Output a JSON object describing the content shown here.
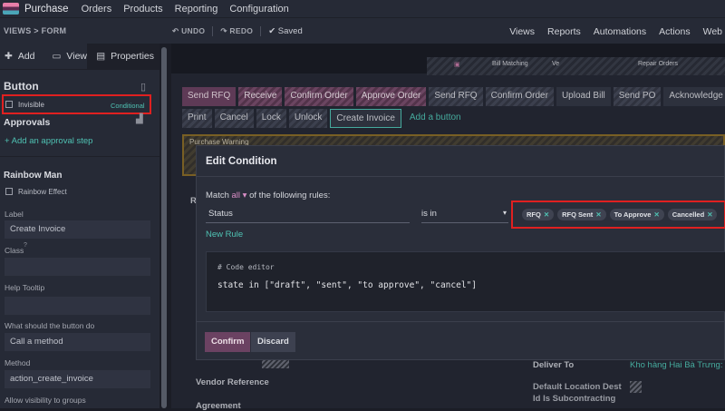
{
  "app": {
    "name": "Purchase",
    "menu": [
      "Orders",
      "Products",
      "Reporting",
      "Configuration"
    ]
  },
  "subbar": {
    "breadcrumb": "VIEWS  >  FORM",
    "undo": "UNDO",
    "redo": "REDO",
    "saved": "Saved",
    "right_menu": [
      "Views",
      "Reports",
      "Automations",
      "Actions",
      "Web"
    ]
  },
  "sidebar": {
    "tabs": {
      "add": "Add",
      "view": "View",
      "properties": "Properties"
    },
    "section_title": "Button",
    "invisible_label": "Invisible",
    "invisible_badge": "Conditional",
    "approvals_title": "Approvals",
    "add_approval": "Add an approval step",
    "rainbow_title": "Rainbow Man",
    "rainbow_effect": "Rainbow Effect",
    "label_label": "Label",
    "label_value": "Create Invoice",
    "class_label": "Class",
    "tooltip_label": "Help Tooltip",
    "action_label": "What should the button do",
    "action_value": "Call a method",
    "method_label": "Method",
    "method_value": "action_create_invoice",
    "visibility_label": "Allow visibility to groups"
  },
  "smart_buttons": [
    "Bill Matching",
    "Ve",
    "Repair Orders"
  ],
  "header_buttons_row1": [
    "Send RFQ",
    "Receive",
    "Confirm Order",
    "Approve Order",
    "Send RFQ",
    "Confirm Order",
    "Upload Bill",
    "Send PO",
    "Acknowledge"
  ],
  "header_buttons_row2": [
    "Print",
    "Cancel",
    "Lock",
    "Unlock",
    "Create Invoice",
    "Add a button"
  ],
  "warning_text": "Purchase Warning",
  "form_labels": {
    "r": "R",
    "vendor_reference": "Vendor Reference",
    "agreement": "Agreement",
    "deliver_to": "Deliver To",
    "deliver_to_value": "Kho hàng Hai Bà Trưng: Re",
    "default_location": "Default Location Dest",
    "subcontracting": "Id Is Subcontracting"
  },
  "modal": {
    "title": "Edit Condition",
    "match_prefix": "Match",
    "match_all": "all",
    "match_suffix": "of the following rules:",
    "field": "Status",
    "operator": "is in",
    "tags": [
      "RFQ",
      "RFQ Sent",
      "To Approve",
      "Cancelled"
    ],
    "new_rule": "New Rule",
    "code_comment": "# Code editor",
    "code_line": "state in [\"draft\", \"sent\", \"to approve\", \"cancel\"]",
    "confirm": "Confirm",
    "discard": "Discard"
  },
  "colors": {
    "accent": "#4fc2b3",
    "primary": "#6b4262",
    "highlight": "#e02020"
  }
}
